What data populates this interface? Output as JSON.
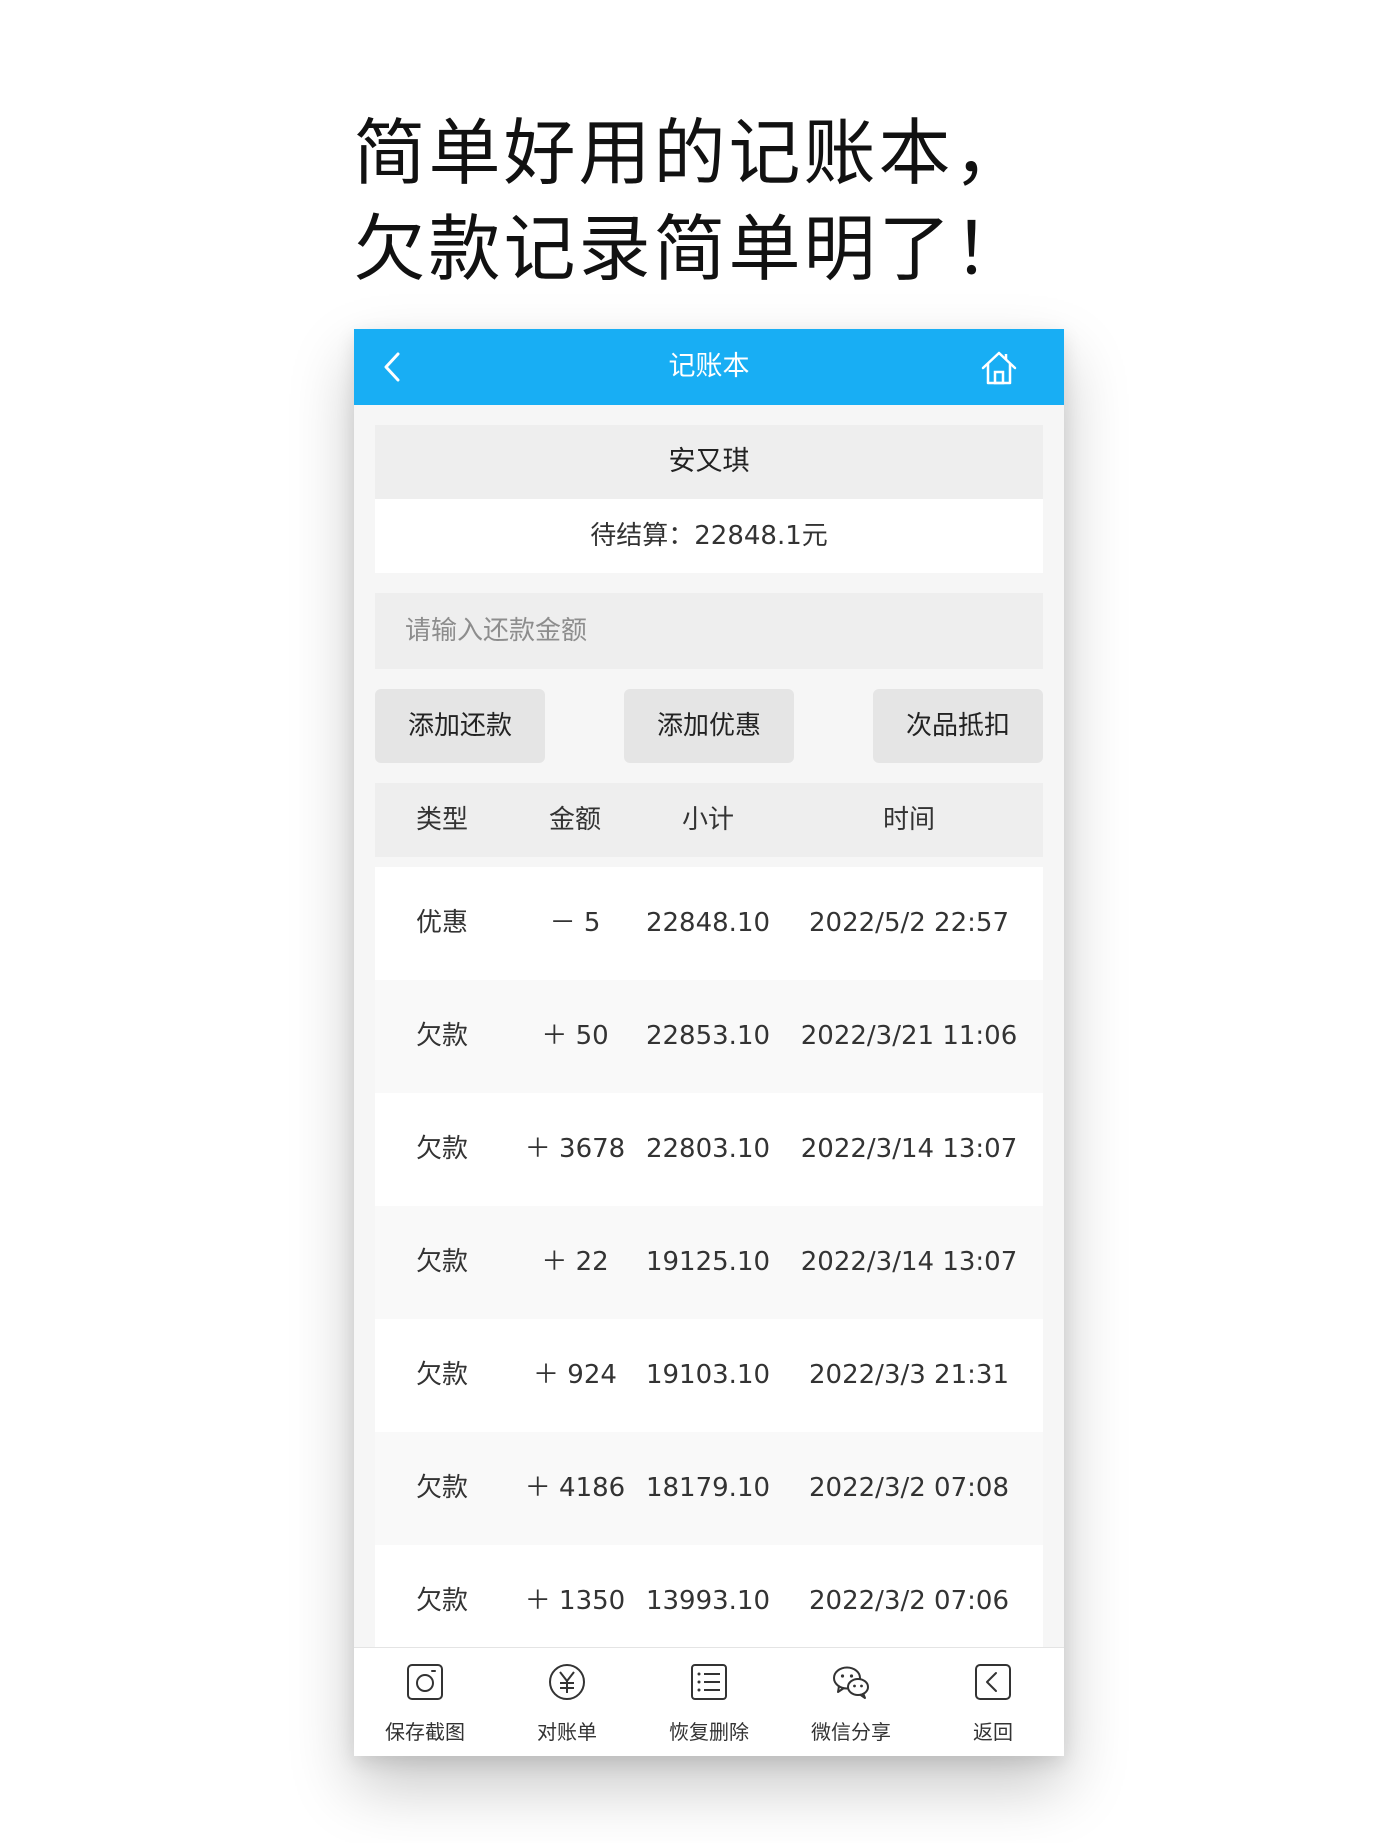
{
  "headline": {
    "line1": "简单好用的记账本，",
    "line2": "欠款记录简单明了！"
  },
  "navbar": {
    "title": "记账本",
    "back_icon": "chevron-left-icon",
    "home_icon": "home-icon"
  },
  "account": {
    "name": "安又琪",
    "balance_text": "待结算：22848.1元"
  },
  "repay_input": {
    "placeholder": "请输入还款金额",
    "value": ""
  },
  "buttons": {
    "add_repayment": "添加还款",
    "add_discount": "添加优惠",
    "defect_deduction": "次品抵扣"
  },
  "table": {
    "headers": [
      "类型",
      "金额",
      "小计",
      "时间"
    ],
    "rows": [
      {
        "type": "优惠",
        "amount": "－ 5",
        "subtotal": "22848.10",
        "time": "2022/5/2 22:57"
      },
      {
        "type": "欠款",
        "amount": "＋ 50",
        "subtotal": "22853.10",
        "time": "2022/3/21 11:06"
      },
      {
        "type": "欠款",
        "amount": "＋ 3678",
        "subtotal": "22803.10",
        "time": "2022/3/14 13:07"
      },
      {
        "type": "欠款",
        "amount": "＋ 22",
        "subtotal": "19125.10",
        "time": "2022/3/14 13:07"
      },
      {
        "type": "欠款",
        "amount": "＋ 924",
        "subtotal": "19103.10",
        "time": "2022/3/3 21:31"
      },
      {
        "type": "欠款",
        "amount": "＋ 4186",
        "subtotal": "18179.10",
        "time": "2022/3/2 07:08"
      },
      {
        "type": "欠款",
        "amount": "＋ 1350",
        "subtotal": "13993.10",
        "time": "2022/3/2 07:06"
      }
    ]
  },
  "tabbar": {
    "items": [
      {
        "label": "保存截图",
        "icon": "camera-icon"
      },
      {
        "label": "对账单",
        "icon": "yen-icon"
      },
      {
        "label": "恢复删除",
        "icon": "list-icon"
      },
      {
        "label": "微信分享",
        "icon": "wechat-icon"
      },
      {
        "label": "返回",
        "icon": "back-icon"
      }
    ]
  },
  "colors": {
    "navbar": "#18aef4",
    "page_bg": "#f6f6f6",
    "card_bg": "#eeeeee",
    "button_bg": "#e5e5e5"
  }
}
